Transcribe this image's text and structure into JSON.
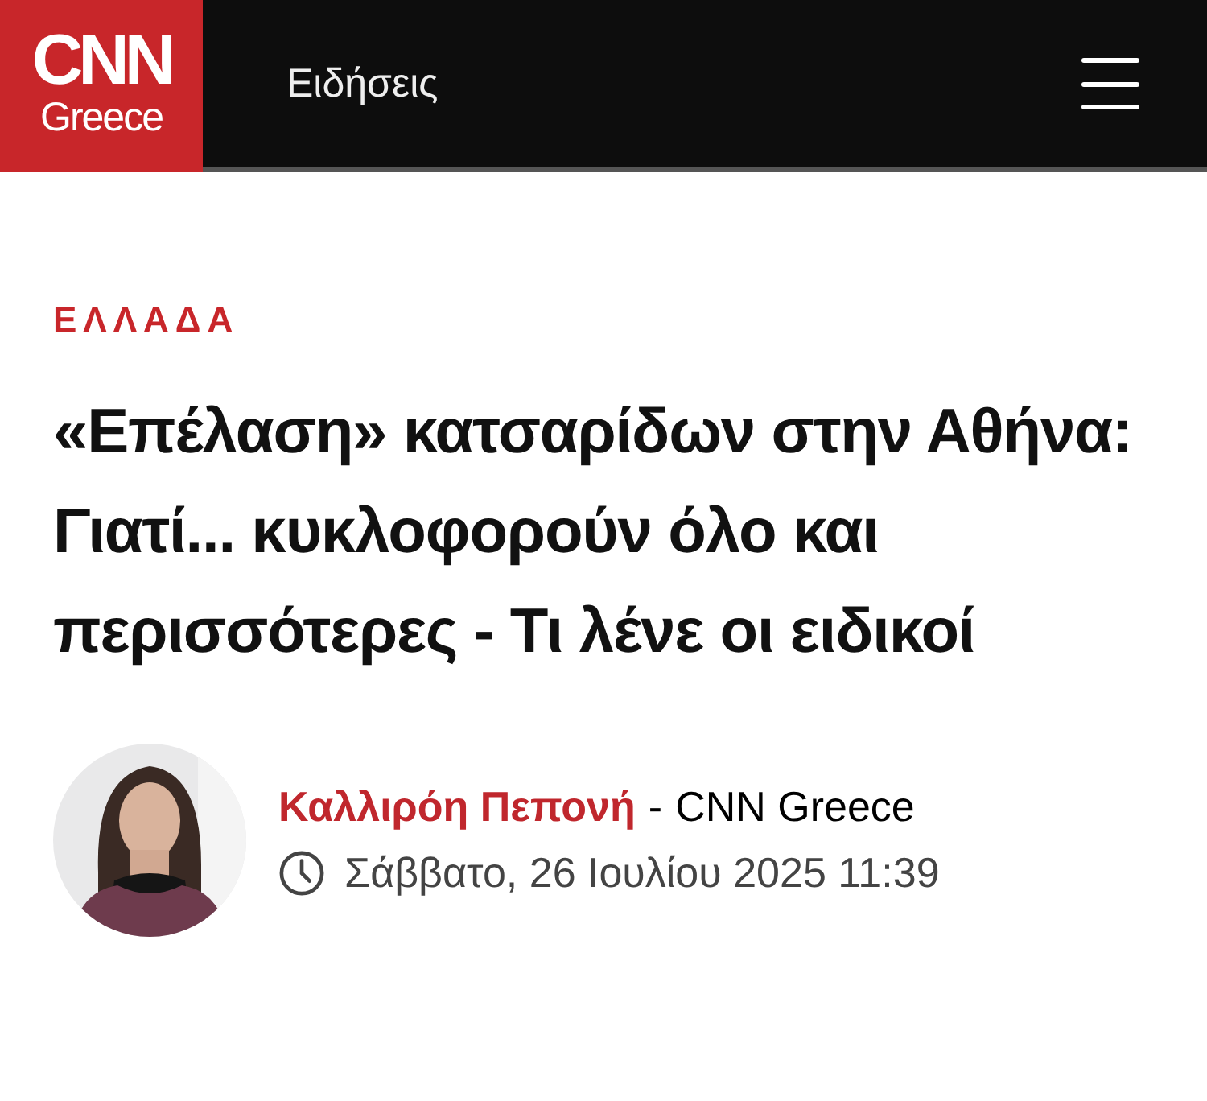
{
  "header": {
    "logo": {
      "wordmark": "CNN",
      "edition": "Greece"
    },
    "section": "Ειδήσεις"
  },
  "article": {
    "category": "ΕΛΛΑΔΑ",
    "headline": "«Επέλαση» κατσαρίδων στην Αθήνα: Γιατί... κυκλοφορούν όλο και περισσότερες - Τι λένε οι ειδικοί",
    "byline": {
      "author": "Καλλιρόη Πεπονή",
      "separator": "-",
      "outlet": "CNN Greece",
      "date": "Σάββατο, 26 Ιουλίου 2025 11:39"
    }
  }
}
